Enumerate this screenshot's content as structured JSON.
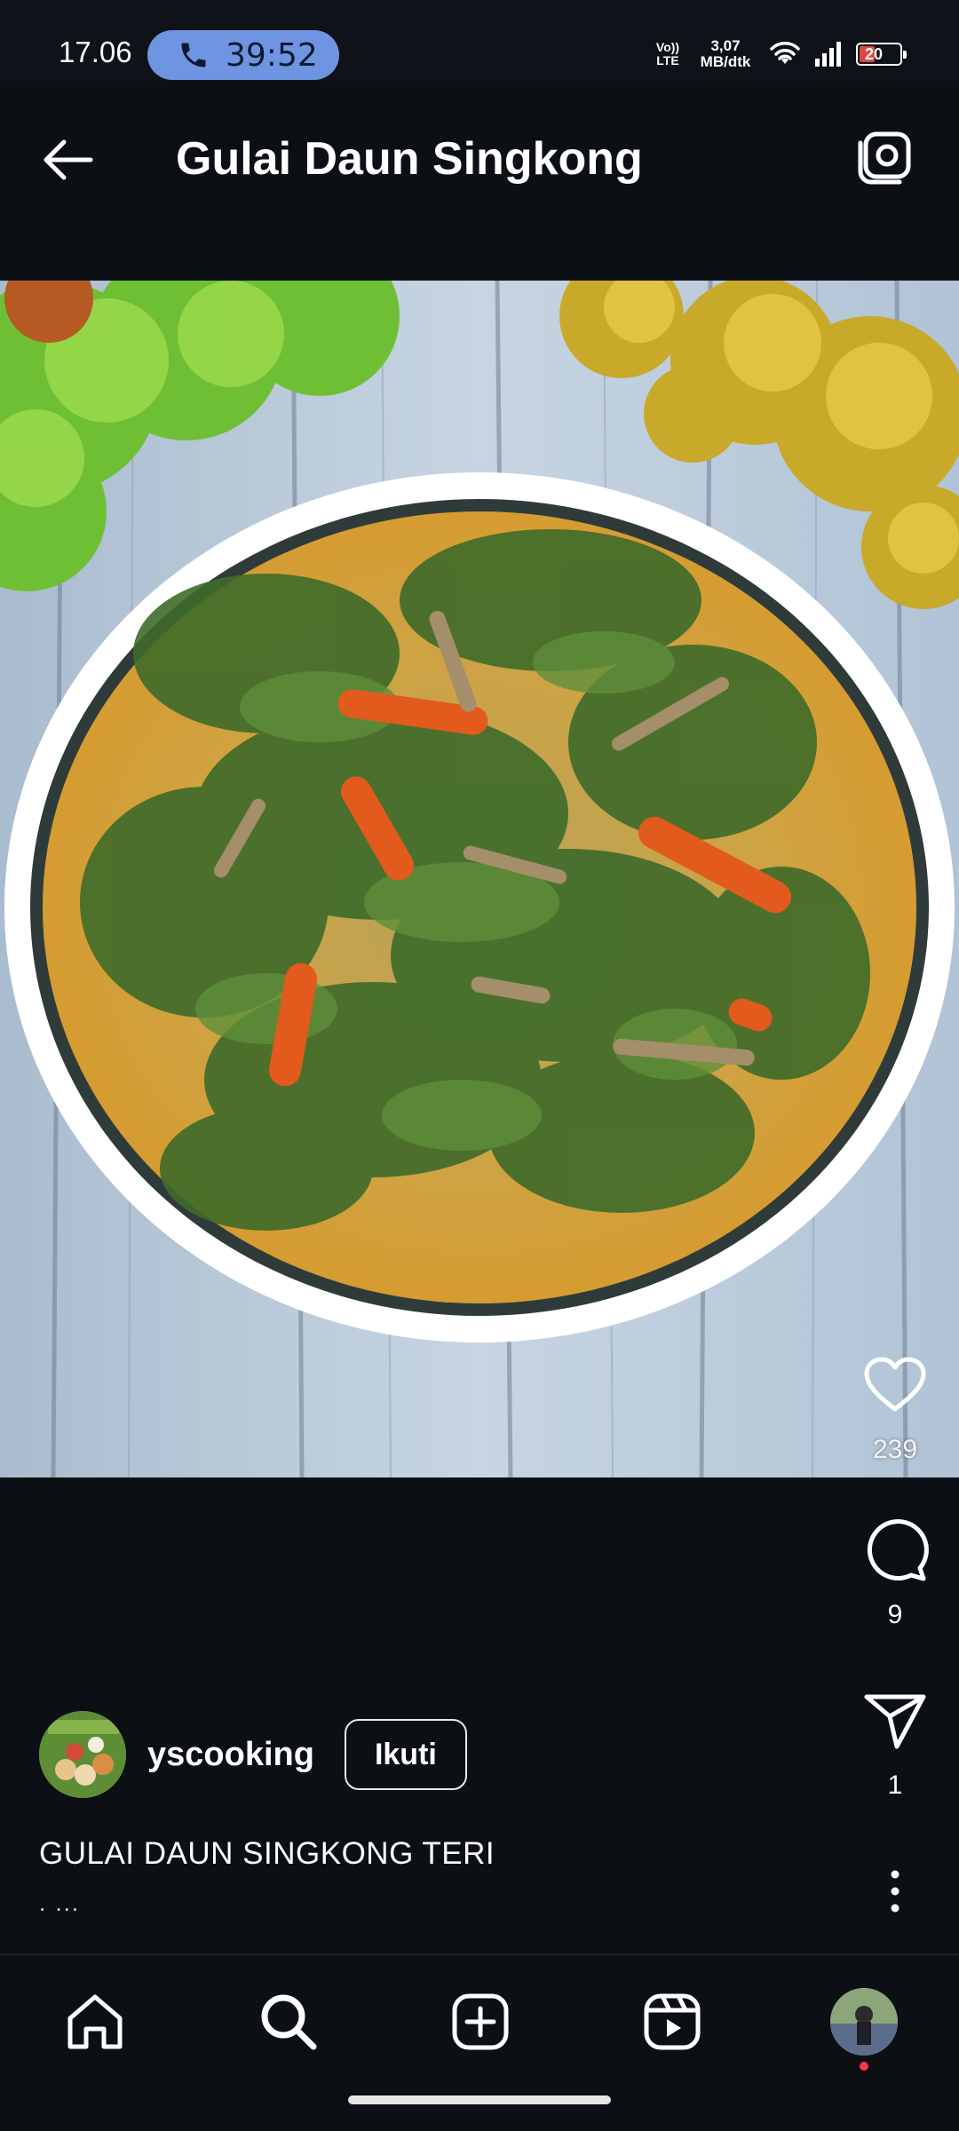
{
  "status_bar": {
    "time": "17.06",
    "call_timer": "39:52",
    "volte_line1": "Vo))",
    "volte_line2": "LTE",
    "net_speed_value": "3,07",
    "net_speed_unit": "MB/dtk",
    "battery_level": "20",
    "battery_color": "#e04545"
  },
  "header": {
    "title": "Gulai Daun Singkong",
    "back_icon": "arrow-left-icon",
    "camera_icon": "camera-icon"
  },
  "post": {
    "image_subject": "food-photo",
    "likes": "239",
    "comments": "9",
    "shares": "1",
    "author": {
      "username": "yscooking",
      "follow_label": "Ikuti"
    },
    "caption": "GULAI DAUN SINGKONG TERI",
    "caption_more": ". ..."
  },
  "bottom_nav": {
    "items": [
      {
        "icon": "home-icon"
      },
      {
        "icon": "search-icon"
      },
      {
        "icon": "add-post-icon"
      },
      {
        "icon": "reels-icon"
      },
      {
        "icon": "profile-avatar"
      }
    ]
  },
  "colors": {
    "background": "#0c1014",
    "call_pill": "#6f95e2",
    "notification_dot": "#ff3050"
  }
}
